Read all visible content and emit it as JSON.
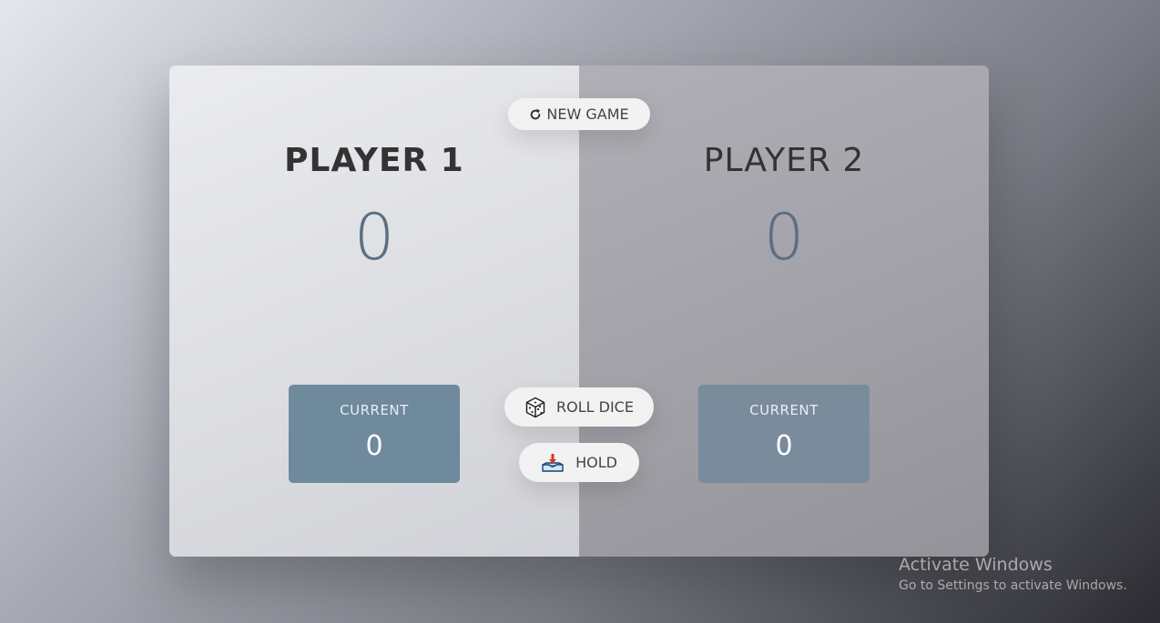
{
  "buttons": {
    "new_game": {
      "label": "NEW GAME",
      "icon": "refresh-icon"
    },
    "roll_dice": {
      "label": "ROLL DICE",
      "icon": "dice-icon"
    },
    "hold": {
      "label": "HOLD",
      "icon": "hold-icon"
    }
  },
  "players": [
    {
      "name": "PLAYER 1",
      "score": "0",
      "current_label": "CURRENT",
      "current_score": "0",
      "active": true
    },
    {
      "name": "PLAYER 2",
      "score": "0",
      "current_label": "CURRENT",
      "current_score": "0",
      "active": false
    }
  ],
  "watermark": {
    "title": "Activate Windows",
    "subtitle": "Go to Settings to activate Windows."
  },
  "colors": {
    "current_box": "#6f899d",
    "score_text": "#5a6f83",
    "button_bg": "#f2f2f2"
  }
}
